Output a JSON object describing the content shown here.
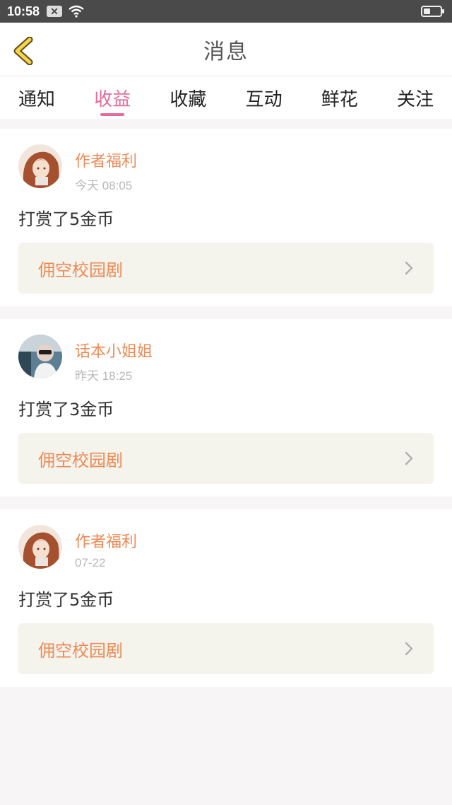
{
  "status_bar": {
    "time": "10:58",
    "notif_icon": "x-icon",
    "wifi_icon": "wifi-icon",
    "battery_icon": "battery-icon",
    "battery_level": 0.4
  },
  "header": {
    "title": "消息",
    "back_icon": "chevron-left-icon"
  },
  "tabs": [
    {
      "label": "通知",
      "active": false
    },
    {
      "label": "收益",
      "active": true
    },
    {
      "label": "收藏",
      "active": false
    },
    {
      "label": "互动",
      "active": false
    },
    {
      "label": "鲜花",
      "active": false
    },
    {
      "label": "关注",
      "active": false
    }
  ],
  "colors": {
    "accent_pink": "#e46b9d",
    "accent_orange": "#ee8a55",
    "link_bg": "#f4f3ec"
  },
  "messages": [
    {
      "author": "作者福利",
      "time": "今天 08:05",
      "text": "打赏了5金币",
      "work": "佣空校园剧",
      "avatar": "anime-girl-avatar"
    },
    {
      "author": "话本小姐姐",
      "time": "昨天 18:25",
      "text": "打赏了3金币",
      "work": "佣空校园剧",
      "avatar": "sunglasses-avatar"
    },
    {
      "author": "作者福利",
      "time": "07-22",
      "text": "打赏了5金币",
      "work": "佣空校园剧",
      "avatar": "anime-girl-avatar"
    }
  ]
}
